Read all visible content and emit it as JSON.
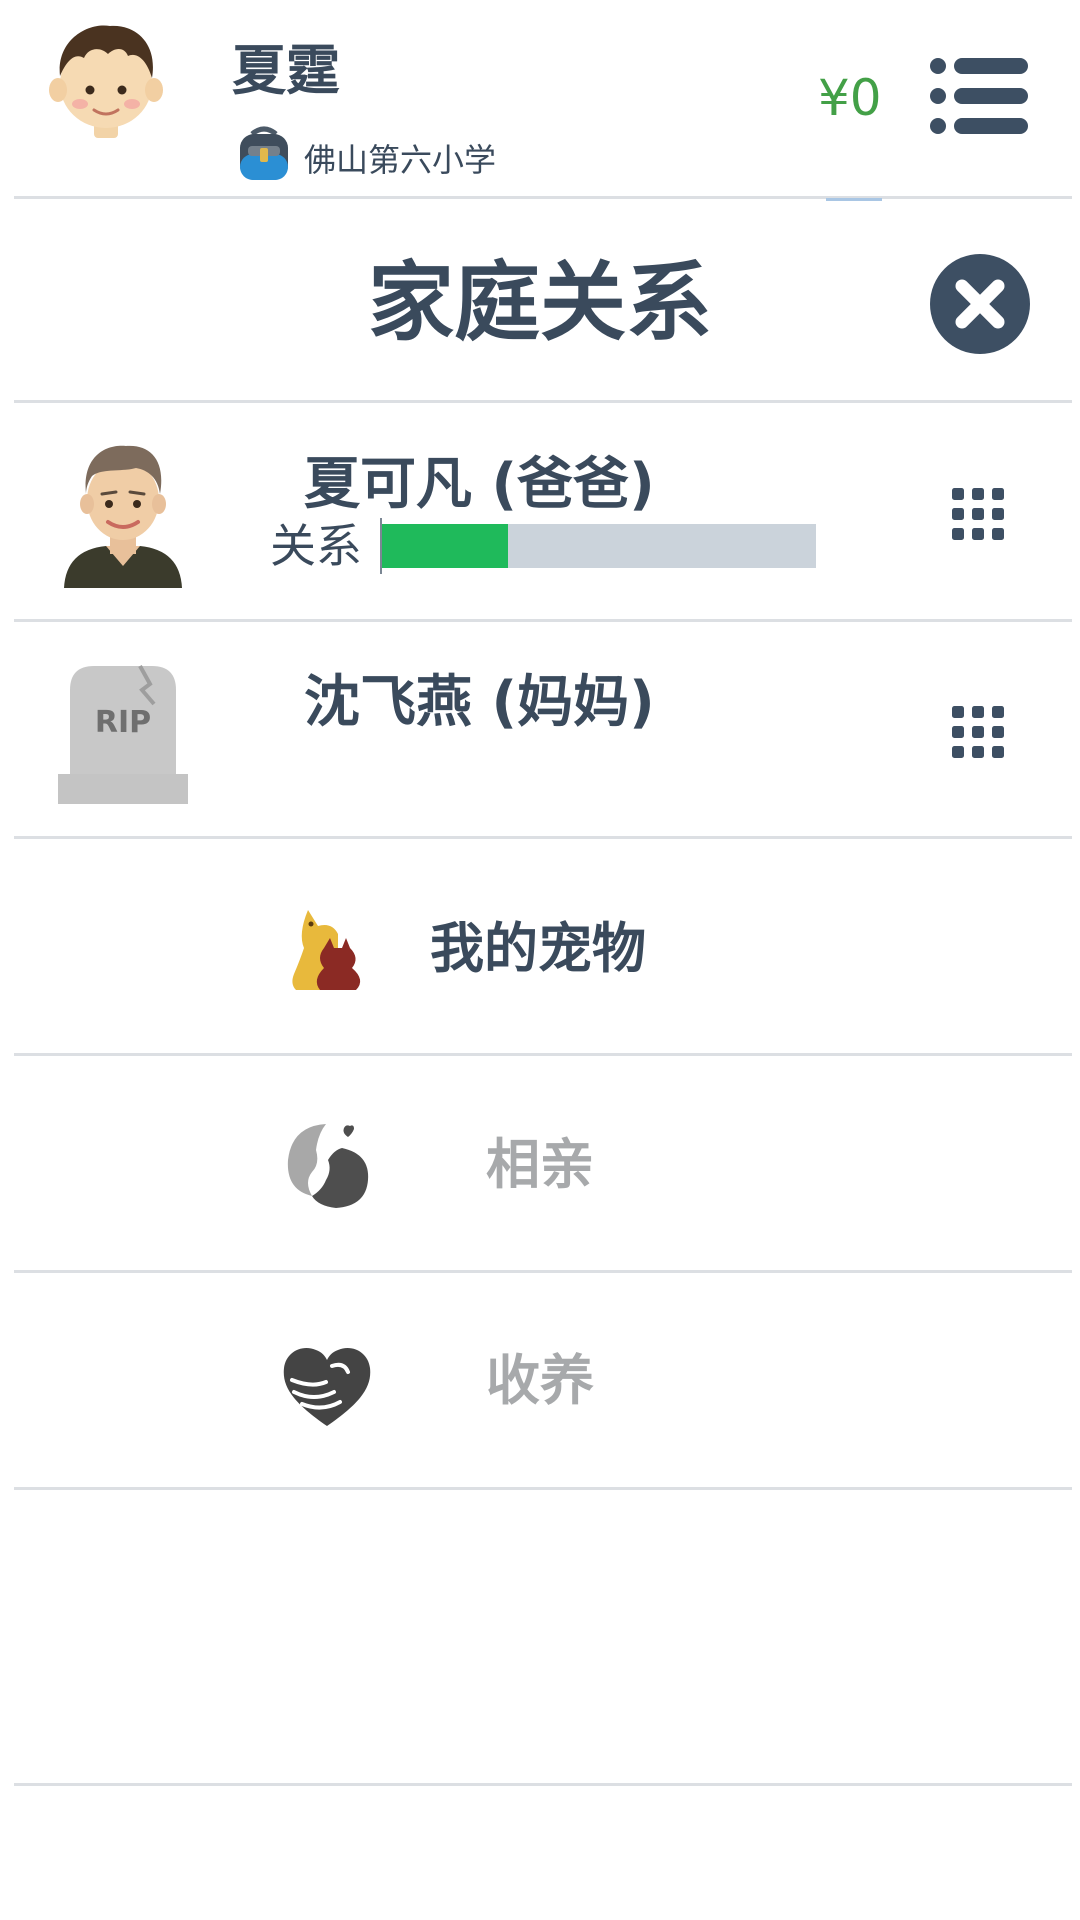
{
  "header": {
    "player_name": "夏霆",
    "school_name": "佛山第六小学",
    "money": "¥0",
    "avatar_icon": "boy-avatar-icon",
    "school_icon": "schoolbag-icon",
    "menu_icon": "list-menu-icon"
  },
  "page": {
    "title": "家庭关系",
    "close_icon": "close-icon"
  },
  "family": [
    {
      "name": "夏可凡 (爸爸)",
      "relation_label": "关系",
      "relation_level": 0.29,
      "avatar_icon": "father-avatar-icon",
      "action_icon": "grid-menu-icon"
    },
    {
      "name": "沈飞燕 (妈妈)",
      "avatar_icon": "rip-tombstone-icon",
      "action_icon": "grid-menu-icon"
    }
  ],
  "menu": [
    {
      "label": "我的宠物",
      "icon": "pet-icon",
      "enabled": true
    },
    {
      "label": "相亲",
      "icon": "dating-icon",
      "enabled": false
    },
    {
      "label": "收养",
      "icon": "adoption-heart-icon",
      "enabled": false
    }
  ],
  "colors": {
    "text": "#3a4a5c",
    "money": "#43a047",
    "relation_fill": "#1fba5b",
    "relation_track": "#cbd3db",
    "disabled_text": "#a7a9ab",
    "divider": "#dcdfe3"
  }
}
